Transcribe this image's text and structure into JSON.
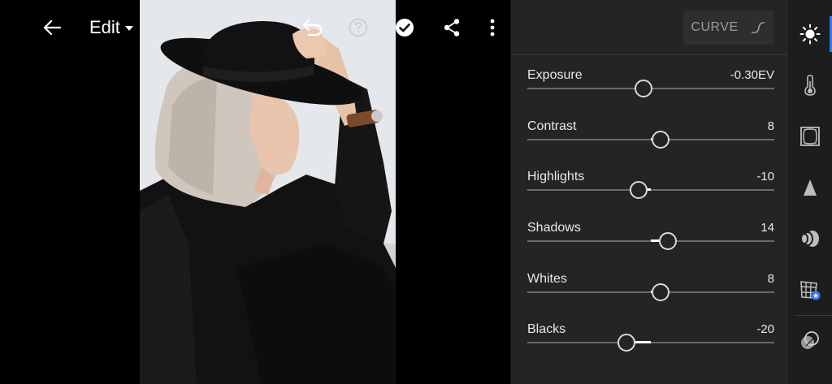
{
  "toolbar": {
    "edit_label": "Edit"
  },
  "panel": {
    "curve_label": "CURVE",
    "sliders": [
      {
        "label": "Exposure",
        "value": "-0.30EV",
        "position": 0.47
      },
      {
        "label": "Contrast",
        "value": "8",
        "position": 0.54
      },
      {
        "label": "Highlights",
        "value": "-10",
        "position": 0.45
      },
      {
        "label": "Shadows",
        "value": "14",
        "position": 0.57
      },
      {
        "label": "Whites",
        "value": "8",
        "position": 0.54
      },
      {
        "label": "Blacks",
        "value": "-20",
        "position": 0.4
      }
    ]
  },
  "rail": {
    "tools": [
      "light-icon",
      "color-icon",
      "effects-icon",
      "detail-icon",
      "optics-icon",
      "geometry-icon",
      "masking-icon"
    ],
    "accent_color": "#2d7cf6"
  }
}
